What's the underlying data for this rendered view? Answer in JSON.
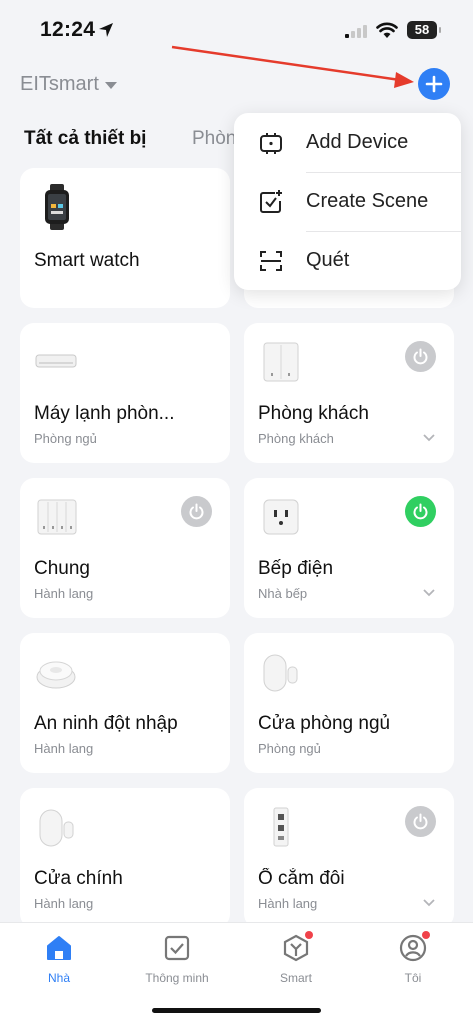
{
  "status_bar": {
    "time": "12:24",
    "battery": "58"
  },
  "header": {
    "home_name": "EITsmart",
    "add_icon": "plus-icon"
  },
  "tabs": {
    "all": "Tất cả thiết bị",
    "rooms": "Phòn"
  },
  "menu": {
    "items": [
      {
        "label": "Add Device",
        "icon": "add-device-icon"
      },
      {
        "label": "Create Scene",
        "icon": "create-scene-icon"
      },
      {
        "label": "Quét",
        "icon": "scan-icon"
      }
    ]
  },
  "devices": [
    {
      "name": "Smart watch",
      "room": "",
      "icon": "smartwatch-icon",
      "power": null
    },
    {
      "name": "",
      "room": "",
      "icon": "",
      "power": null
    },
    {
      "name": "Máy lạnh phòn...",
      "room": "Phòng ngủ",
      "icon": "air-conditioner-icon",
      "power": null
    },
    {
      "name": "Phòng khách",
      "room": "Phòng khách",
      "icon": "wall-switch-icon",
      "power": "off"
    },
    {
      "name": "Chung",
      "room": "Hành lang",
      "icon": "triple-switch-icon",
      "power": "off"
    },
    {
      "name": "Bếp điện",
      "room": "Nhà bếp",
      "icon": "smart-plug-icon",
      "power": "on"
    },
    {
      "name": "An ninh đột nhập",
      "room": "Hành lang",
      "icon": "motion-sensor-icon",
      "power": null
    },
    {
      "name": "Cửa phòng ngủ",
      "room": "Phòng ngủ",
      "icon": "door-sensor-icon",
      "power": null
    },
    {
      "name": "Cửa chính",
      "room": "Hành lang",
      "icon": "door-sensor-icon",
      "power": null
    },
    {
      "name": "Ổ cắm đôi",
      "room": "Hành lang",
      "icon": "power-strip-icon",
      "power": "off"
    }
  ],
  "bottom_nav": [
    {
      "label": "Nhà",
      "icon": "home-icon",
      "active": true
    },
    {
      "label": "Thông minh",
      "icon": "checkbox-icon",
      "active": false
    },
    {
      "label": "Smart",
      "icon": "smart-hex-icon",
      "active": false,
      "badge": true
    },
    {
      "label": "Tôi",
      "icon": "profile-icon",
      "active": false,
      "badge": true
    }
  ],
  "colors": {
    "accent": "#2f7ff5",
    "power_on": "#30cf61",
    "power_off": "#c9cacd",
    "badge": "#f0424a",
    "annotation_arrow": "#e53b2c"
  }
}
